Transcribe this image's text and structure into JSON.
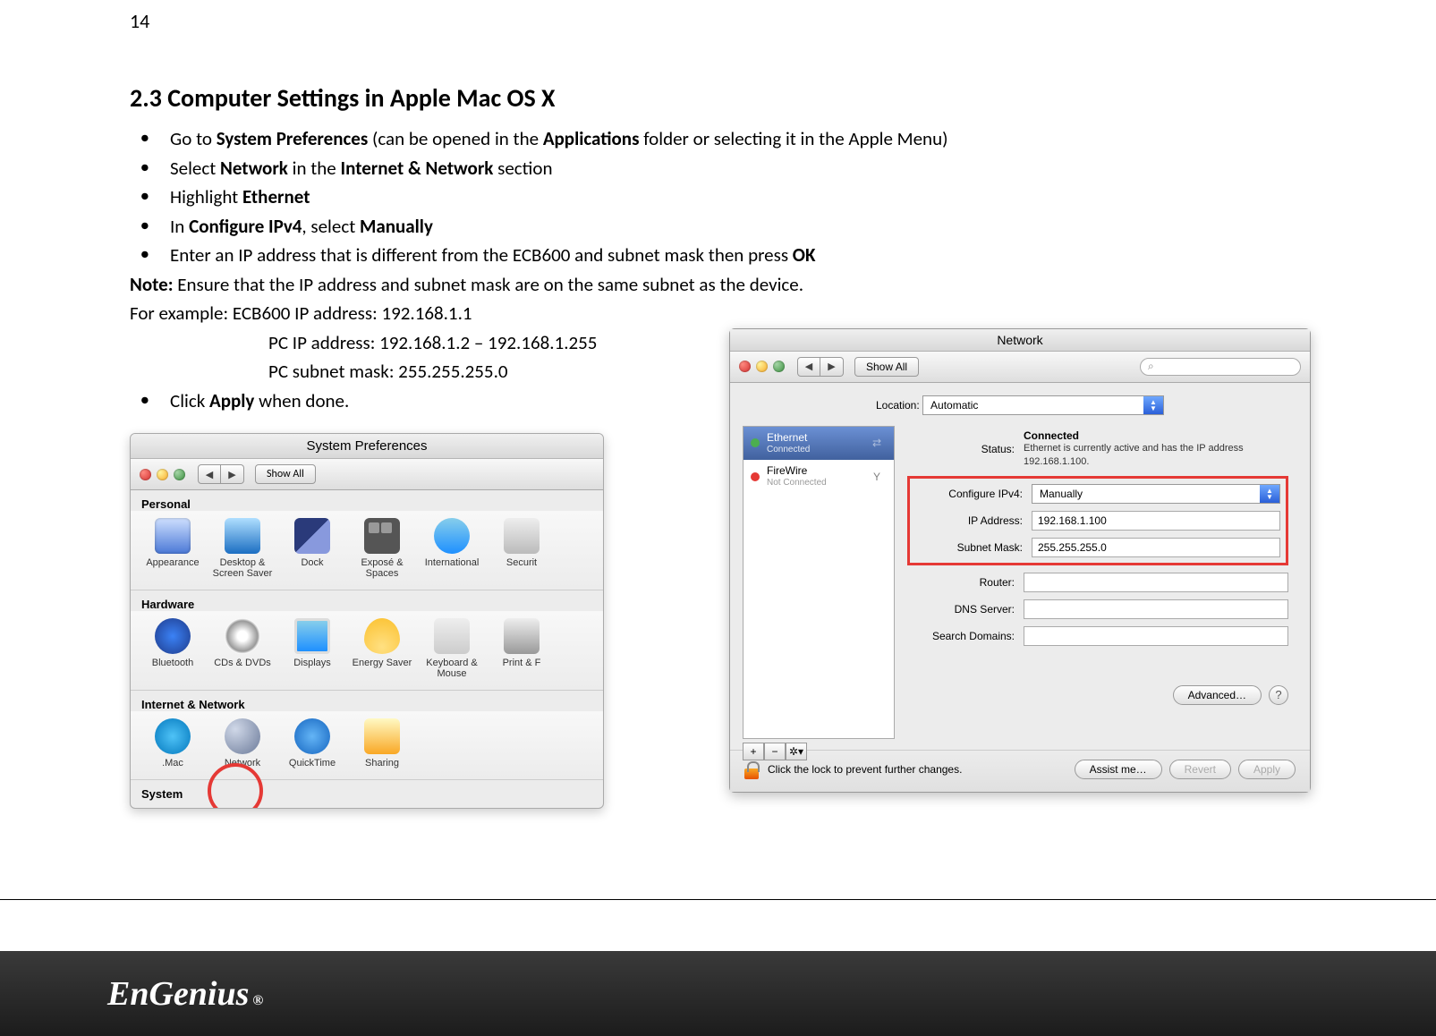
{
  "page_number": "14",
  "heading": "2.3   Computer Settings in Apple Mac OS X",
  "bullets": [
    {
      "pre": "Go to ",
      "b1": "System Preferences",
      "mid": " (can be opened in the ",
      "b2": "Applications",
      "post": " folder or selecting it in the Apple Menu)"
    },
    {
      "pre": "Select ",
      "b1": "Network",
      "mid": " in the ",
      "b2": "Internet & Network",
      "post": " section"
    },
    {
      "pre": "Highlight ",
      "b1": "Ethernet",
      "mid": "",
      "b2": "",
      "post": ""
    },
    {
      "pre": "In ",
      "b1": "Configure IPv4",
      "mid": ", select ",
      "b2": "Manually",
      "post": ""
    },
    {
      "pre": "Enter an IP address that is different from the ECB600 and subnet mask then press ",
      "b1": "OK",
      "mid": "",
      "b2": "",
      "post": ""
    }
  ],
  "note_label": "Note:",
  "note_text": " Ensure that the IP address and subnet mask are on the same subnet as the device.",
  "example_label": "For example:",
  "example_line1": " ECB600 IP address: 192.168.1.1",
  "example_line2": "PC IP address: 192.168.1.2 – 192.168.1.255",
  "example_line3": "PC subnet mask: 255.255.255.0",
  "bullet_apply_pre": "Click ",
  "bullet_apply_b": "Apply",
  "bullet_apply_post": " when done.",
  "sysprefs": {
    "title": "System Preferences",
    "show_all": "Show All",
    "sections": {
      "personal": "Personal",
      "hardware": "Hardware",
      "internet": "Internet & Network",
      "system": "System"
    },
    "icons": {
      "appearance": "Appearance",
      "desktop": "Desktop & Screen Saver",
      "dock": "Dock",
      "expose": "Exposé & Spaces",
      "international": "International",
      "security": "Securit",
      "bluetooth": "Bluetooth",
      "cds": "CDs & DVDs",
      "displays": "Displays",
      "energy": "Energy Saver",
      "keyboard": "Keyboard & Mouse",
      "print": "Print & F",
      "mac": ".Mac",
      "network": "Network",
      "quicktime": "QuickTime",
      "sharing": "Sharing"
    }
  },
  "network": {
    "title": "Network",
    "show_all": "Show All",
    "location_label": "Location:",
    "location_value": "Automatic",
    "sidebar": {
      "ethernet": "Ethernet",
      "ethernet_sub": "Connected",
      "firewire": "FireWire",
      "firewire_sub": "Not Connected"
    },
    "status_label": "Status:",
    "status_value": "Connected",
    "status_msg": "Ethernet is currently active and has the IP address 192.168.1.100.",
    "configure_label": "Configure IPv4:",
    "configure_value": "Manually",
    "ip_label": "IP Address:",
    "ip_value": "192.168.1.100",
    "subnet_label": "Subnet Mask:",
    "subnet_value": "255.255.255.0",
    "router_label": "Router:",
    "dns_label": "DNS Server:",
    "search_label": "Search Domains:",
    "advanced": "Advanced…",
    "lock_text": "Click the lock to prevent further changes.",
    "assist": "Assist me…",
    "revert": "Revert",
    "apply": "Apply"
  },
  "logo": "EnGenius",
  "logo_reg": "®"
}
